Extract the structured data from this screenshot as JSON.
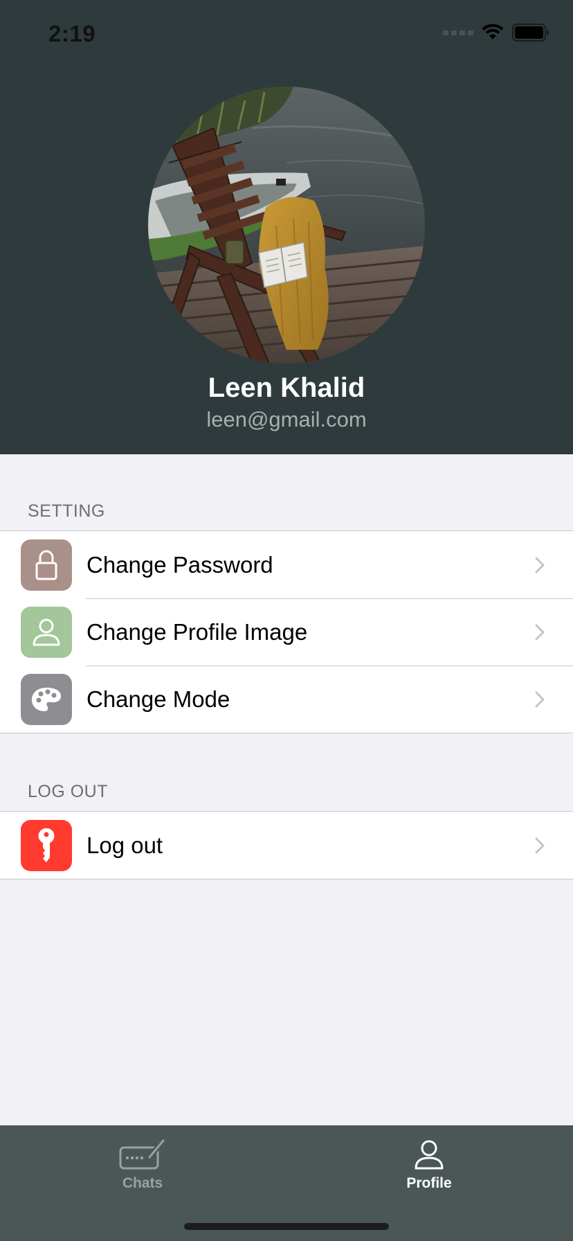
{
  "status_bar": {
    "time": "2:19"
  },
  "profile": {
    "name": "Leen Khalid",
    "email": "leen@gmail.com",
    "avatar_description_icon": "profile-photo"
  },
  "settings_section": {
    "header": "SETTING",
    "items": [
      {
        "label": "Change Password",
        "icon": "lock-icon",
        "icon_bg": "#a99089"
      },
      {
        "label": "Change Profile Image",
        "icon": "person-icon",
        "icon_bg": "#a3c69b"
      },
      {
        "label": "Change Mode",
        "icon": "palette-icon",
        "icon_bg": "#8e8d92"
      }
    ]
  },
  "logout_section": {
    "header": "LOG OUT",
    "items": [
      {
        "label": "Log out",
        "icon": "key-icon",
        "icon_bg": "#ff3b30"
      }
    ]
  },
  "tab_bar": {
    "tabs": [
      {
        "label": "Chats",
        "icon": "compose-keyboard-icon",
        "active": false
      },
      {
        "label": "Profile",
        "icon": "person-icon",
        "active": true
      }
    ]
  },
  "colors": {
    "header_bg": "#2f3a3c",
    "page_bg": "#f2f1f6",
    "tab_bar_bg": "#4b5657",
    "tab_active": "#ffffff",
    "tab_inactive": "#9aa2a3"
  }
}
